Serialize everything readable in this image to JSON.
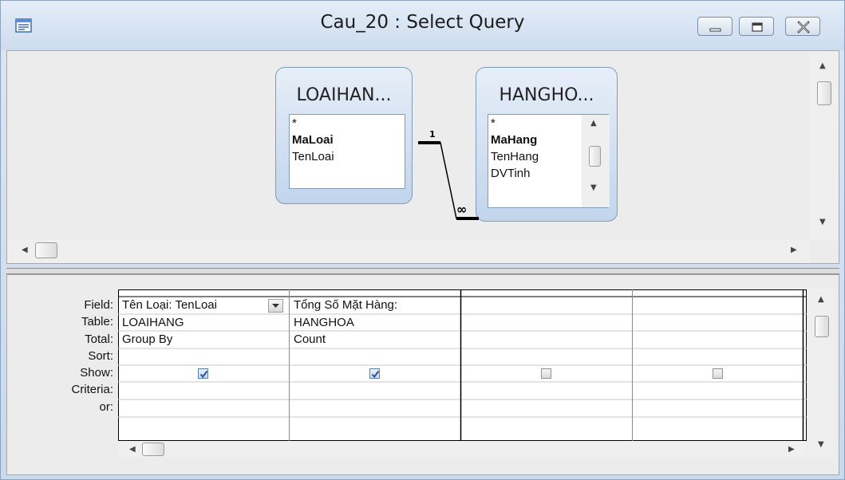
{
  "window": {
    "title": "Cau_20 : Select Query"
  },
  "tables": [
    {
      "title": "LOAIHAN...",
      "fields": [
        "*",
        "MaLoai",
        "TenLoai"
      ],
      "key_field": "MaLoai"
    },
    {
      "title": "HANGHO...",
      "fields": [
        "*",
        "MaHang",
        "TenHang",
        "DVTinh"
      ],
      "key_field": "MaHang"
    }
  ],
  "relationship": {
    "one_side": "1",
    "many_side": "∞"
  },
  "grid": {
    "row_labels": [
      "Field:",
      "Table:",
      "Total:",
      "Sort:",
      "Show:",
      "Criteria:",
      "or:"
    ],
    "columns": [
      {
        "field": "Tên Loại: TenLoai",
        "table": "LOAIHANG",
        "total": "Group By",
        "sort": "",
        "show": true,
        "criteria": "",
        "or": ""
      },
      {
        "field": "Tổng Số Mặt Hàng:",
        "table": "HANGHOA",
        "total": "Count",
        "sort": "",
        "show": true,
        "criteria": "",
        "or": ""
      },
      {
        "field": "",
        "table": "",
        "total": "",
        "sort": "",
        "show": false,
        "criteria": "",
        "or": ""
      },
      {
        "field": "",
        "table": "",
        "total": "",
        "sort": "",
        "show": false,
        "criteria": "",
        "or": ""
      }
    ]
  },
  "icons": {
    "app": "query-window-icon",
    "minimize": "minimize-icon",
    "restore": "restore-icon",
    "close": "close-icon"
  },
  "colors": {
    "title_bar": "#cddcef",
    "table_header": "#c2d5ec",
    "check": "#2c4f9e"
  }
}
